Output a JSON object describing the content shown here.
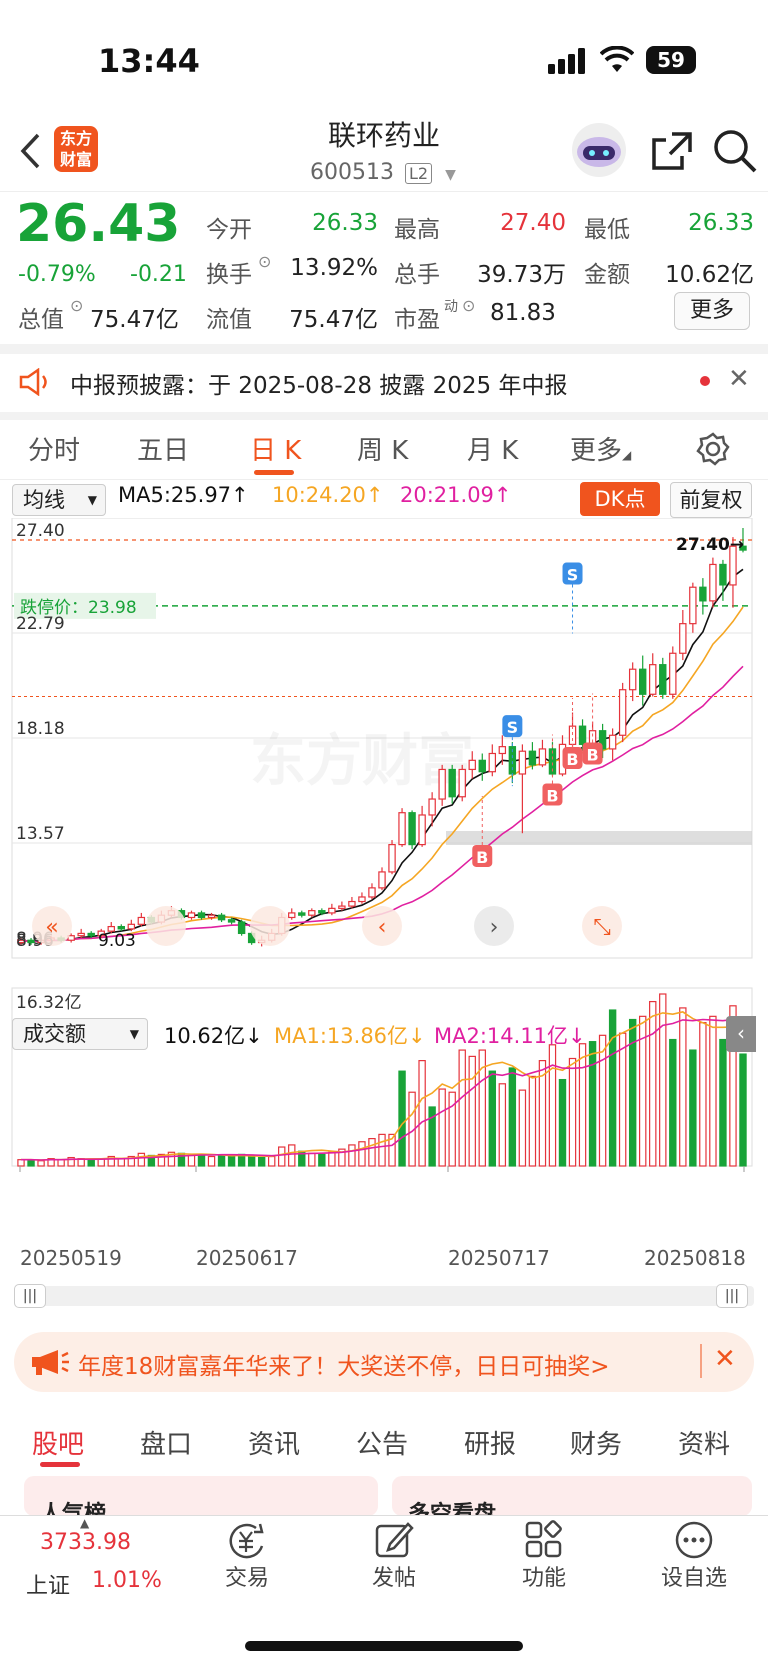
{
  "status": {
    "time": "13:44",
    "battery": "59"
  },
  "header": {
    "title": "联环药业",
    "code": "600513",
    "level": "L2",
    "logo_text": [
      "东方",
      "财富"
    ]
  },
  "quote": {
    "price": "26.43",
    "change_pct": "-0.79%",
    "change": "-0.21",
    "open_label": "今开",
    "open": "26.33",
    "high_label": "最高",
    "high": "27.40",
    "low_label": "最低",
    "low": "26.33",
    "turnover_label": "换手",
    "turnover": "13.92%",
    "volume_label": "总手",
    "volume": "39.73万",
    "amount_label": "金额",
    "amount": "10.62亿",
    "mktcap_label": "总值",
    "mktcap": "75.47亿",
    "float_label": "流值",
    "float": "75.47亿",
    "pe_label": "市盈",
    "pe_sup": "动",
    "pe": "81.83",
    "more": "更多"
  },
  "notice": {
    "text": "中报预披露：于 2025-08-28 披露 2025 年中报"
  },
  "tabs": [
    "分时",
    "五日",
    "日 K",
    "周 K",
    "月 K",
    "更多"
  ],
  "ma_bar": {
    "selector": "均线",
    "ma5": "MA5:25.97",
    "ma10": "10:24.20",
    "ma20": "20:21.09",
    "dk": "DK点",
    "fq": "前复权"
  },
  "chart_data": {
    "type": "candlestick",
    "price_labels": [
      "27.40",
      "22.79",
      "18.18",
      "13.57",
      "8.96"
    ],
    "price_ylim": [
      8.96,
      27.4
    ],
    "limit_label": "跌停价：23.98",
    "high_marker": "27.40→",
    "low_marker": "9.03",
    "markers": [
      "S",
      "S",
      "B",
      "B",
      "B",
      "B"
    ],
    "watermark": "东方财富",
    "volume_selector": "成交额",
    "volume_value": "10.62亿",
    "vol_ma1": "MA1:13.86亿",
    "vol_ma2": "MA2:14.11亿",
    "volume_max": "16.32亿",
    "x_labels": [
      "20250519",
      "20250617",
      "20250717",
      "20250818"
    ],
    "colors": {
      "up": "#e5333b",
      "down": "#18a338",
      "ma5": "#111111",
      "ma10": "#f5a623",
      "ma20": "#e020a0"
    },
    "candles": [
      [
        9.2,
        9.3,
        9.1,
        9.4
      ],
      [
        9.3,
        9.2,
        9.1,
        9.4
      ],
      [
        9.2,
        9.3,
        9.1,
        9.4
      ],
      [
        9.3,
        9.4,
        9.2,
        9.5
      ],
      [
        9.4,
        9.3,
        9.2,
        9.5
      ],
      [
        9.3,
        9.5,
        9.2,
        9.6
      ],
      [
        9.5,
        9.6,
        9.4,
        9.8
      ],
      [
        9.6,
        9.5,
        9.4,
        9.7
      ],
      [
        9.5,
        9.7,
        9.4,
        9.8
      ],
      [
        9.7,
        9.9,
        9.6,
        10.1
      ],
      [
        9.9,
        9.8,
        9.7,
        10.0
      ],
      [
        9.8,
        10.0,
        9.7,
        10.2
      ],
      [
        10.0,
        10.3,
        9.9,
        10.5
      ],
      [
        10.3,
        10.1,
        10.0,
        10.4
      ],
      [
        10.1,
        10.4,
        10.0,
        10.6
      ],
      [
        10.4,
        10.6,
        10.3,
        10.8
      ],
      [
        10.6,
        10.3,
        10.2,
        10.7
      ],
      [
        10.3,
        10.5,
        10.2,
        10.6
      ],
      [
        10.5,
        10.3,
        10.2,
        10.6
      ],
      [
        10.3,
        10.4,
        10.2,
        10.5
      ],
      [
        10.4,
        10.2,
        10.1,
        10.5
      ],
      [
        10.2,
        10.1,
        10.0,
        10.3
      ],
      [
        10.1,
        9.6,
        9.5,
        10.2
      ],
      [
        9.6,
        9.2,
        9.1,
        9.7
      ],
      [
        9.2,
        9.3,
        9.03,
        9.5
      ],
      [
        9.3,
        9.6,
        9.2,
        9.8
      ],
      [
        9.6,
        10.3,
        9.5,
        10.5
      ],
      [
        10.3,
        10.5,
        10.2,
        10.7
      ],
      [
        10.5,
        10.4,
        10.3,
        10.6
      ],
      [
        10.4,
        10.6,
        10.3,
        10.7
      ],
      [
        10.6,
        10.5,
        10.4,
        10.7
      ],
      [
        10.5,
        10.7,
        10.4,
        10.9
      ],
      [
        10.7,
        10.8,
        10.6,
        11.0
      ],
      [
        10.8,
        11.0,
        10.7,
        11.2
      ],
      [
        11.0,
        11.2,
        10.9,
        11.4
      ],
      [
        11.2,
        11.6,
        11.1,
        11.8
      ],
      [
        11.6,
        12.3,
        11.5,
        12.5
      ],
      [
        12.3,
        13.5,
        12.2,
        13.7
      ],
      [
        13.5,
        14.9,
        13.4,
        15.1
      ],
      [
        14.9,
        13.5,
        13.3,
        15.0
      ],
      [
        13.5,
        14.8,
        13.4,
        15.2
      ],
      [
        14.8,
        15.5,
        14.3,
        15.8
      ],
      [
        15.5,
        16.8,
        15.2,
        17.0
      ],
      [
        16.8,
        15.6,
        15.3,
        17.0
      ],
      [
        15.6,
        16.8,
        15.4,
        17.0
      ],
      [
        16.8,
        17.2,
        16.4,
        17.6
      ],
      [
        17.2,
        16.7,
        16.3,
        17.5
      ],
      [
        16.7,
        17.5,
        16.5,
        17.9
      ],
      [
        17.5,
        17.8,
        17.0,
        18.3
      ],
      [
        17.8,
        16.6,
        16.2,
        18.0
      ],
      [
        16.6,
        17.6,
        14.0,
        17.9
      ],
      [
        17.6,
        17.0,
        16.8,
        18.0
      ],
      [
        17.0,
        17.7,
        16.9,
        18.1
      ],
      [
        17.7,
        16.6,
        16.5,
        18.0
      ],
      [
        16.6,
        17.9,
        16.5,
        18.3
      ],
      [
        17.9,
        18.7,
        17.6,
        19.3
      ],
      [
        18.7,
        17.9,
        17.6,
        19.0
      ],
      [
        17.9,
        18.5,
        17.5,
        18.9
      ],
      [
        18.5,
        17.7,
        17.3,
        18.8
      ],
      [
        17.7,
        18.3,
        17.2,
        18.6
      ],
      [
        18.3,
        20.3,
        18.0,
        20.6
      ],
      [
        20.3,
        21.2,
        19.8,
        21.5
      ],
      [
        21.2,
        20.1,
        19.6,
        21.8
      ],
      [
        20.1,
        21.4,
        20.0,
        21.9
      ],
      [
        21.4,
        20.1,
        19.9,
        21.7
      ],
      [
        20.1,
        21.9,
        19.9,
        22.2
      ],
      [
        21.9,
        23.2,
        21.6,
        23.8
      ],
      [
        23.2,
        24.8,
        22.8,
        25.0
      ],
      [
        24.8,
        24.2,
        23.6,
        25.2
      ],
      [
        24.2,
        25.8,
        23.9,
        26.1
      ],
      [
        25.8,
        24.9,
        24.2,
        26.0
      ],
      [
        24.9,
        26.6,
        23.9,
        27.0
      ],
      [
        26.6,
        26.43,
        26.33,
        27.4
      ]
    ],
    "volumes": [
      [
        0.6,
        1
      ],
      [
        0.6,
        0
      ],
      [
        0.5,
        1
      ],
      [
        0.7,
        1
      ],
      [
        0.6,
        1
      ],
      [
        0.8,
        1
      ],
      [
        0.7,
        1
      ],
      [
        0.6,
        0
      ],
      [
        0.7,
        1
      ],
      [
        0.9,
        1
      ],
      [
        0.7,
        1
      ],
      [
        0.9,
        1
      ],
      [
        1.2,
        1
      ],
      [
        1.0,
        0
      ],
      [
        1.1,
        1
      ],
      [
        1.3,
        1
      ],
      [
        1.2,
        0
      ],
      [
        1.0,
        1
      ],
      [
        1.1,
        0
      ],
      [
        0.9,
        1
      ],
      [
        1.0,
        0
      ],
      [
        0.9,
        0
      ],
      [
        1.1,
        0
      ],
      [
        0.9,
        0
      ],
      [
        0.8,
        0
      ],
      [
        0.9,
        1
      ],
      [
        1.8,
        1
      ],
      [
        2.0,
        1
      ],
      [
        1.4,
        0
      ],
      [
        1.2,
        1
      ],
      [
        1.1,
        0
      ],
      [
        1.3,
        1
      ],
      [
        1.6,
        1
      ],
      [
        2.0,
        1
      ],
      [
        2.3,
        1
      ],
      [
        2.6,
        1
      ],
      [
        3.0,
        1
      ],
      [
        3.0,
        1
      ],
      [
        9.0,
        0
      ],
      [
        7.0,
        1
      ],
      [
        10.0,
        1
      ],
      [
        5.6,
        0
      ],
      [
        7.3,
        1
      ],
      [
        7.0,
        1
      ],
      [
        11.0,
        1
      ],
      [
        10.4,
        1
      ],
      [
        11.0,
        1
      ],
      [
        9.0,
        0
      ],
      [
        7.8,
        1
      ],
      [
        9.3,
        0
      ],
      [
        7.2,
        1
      ],
      [
        8.5,
        1
      ],
      [
        10.0,
        1
      ],
      [
        11.5,
        1
      ],
      [
        8.2,
        0
      ],
      [
        10.2,
        1
      ],
      [
        11.6,
        1
      ],
      [
        11.8,
        0
      ],
      [
        12.4,
        1
      ],
      [
        14.8,
        0
      ],
      [
        12.6,
        1
      ],
      [
        13.9,
        0
      ],
      [
        14.2,
        1
      ],
      [
        15.6,
        1
      ],
      [
        16.32,
        1
      ],
      [
        12.0,
        0
      ],
      [
        15.0,
        1
      ],
      [
        11.0,
        0
      ],
      [
        13.6,
        1
      ],
      [
        14.2,
        1
      ],
      [
        12.0,
        0
      ],
      [
        15.2,
        1
      ],
      [
        10.62,
        0
      ]
    ]
  },
  "promo": {
    "text": "年度18财富嘉年华来了！大奖送不停，日日可抽奖>"
  },
  "bottom_tabs": [
    "股吧",
    "盘口",
    "资讯",
    "公告",
    "研报",
    "财务",
    "资料"
  ],
  "peek": [
    "人气榜",
    "多空看盘"
  ],
  "bottom_nav": {
    "index_value": "3733.98",
    "index_name": "上证",
    "index_change": "1.01%",
    "items": [
      "交易",
      "发帖",
      "功能",
      "设自选"
    ]
  }
}
